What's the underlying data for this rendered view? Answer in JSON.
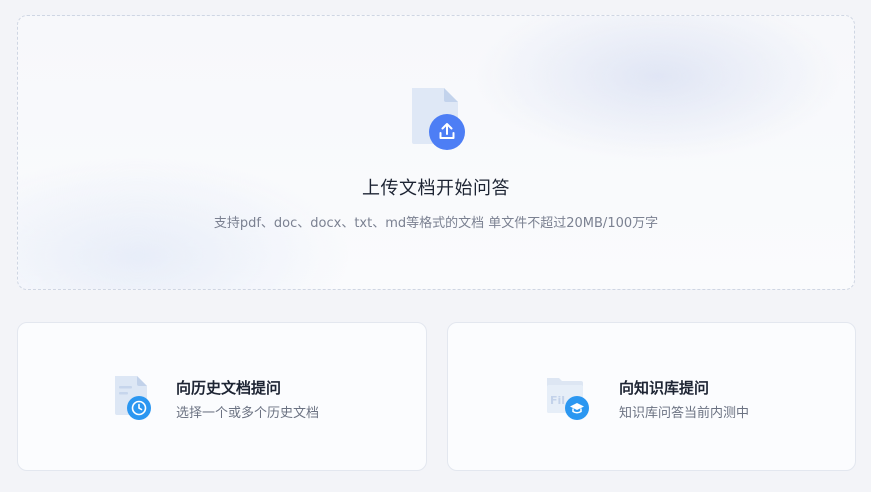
{
  "upload": {
    "title": "上传文档开始问答",
    "subtitle": "支持pdf、doc、docx、txt、md等格式的文档 单文件不超过20MB/100万字",
    "icon": "file-upload-icon"
  },
  "cards": {
    "history": {
      "title": "向历史文档提问",
      "desc": "选择一个或多个历史文档",
      "icon": "history-document-icon"
    },
    "knowledge": {
      "title": "向知识库提问",
      "desc": "知识库问答当前内测中",
      "icon": "knowledge-base-icon"
    }
  },
  "colors": {
    "accent_blue": "#4d7ef5",
    "accent_blue_light": "#2b97f1",
    "text_primary": "#1d2433",
    "text_secondary": "#7b8191"
  }
}
